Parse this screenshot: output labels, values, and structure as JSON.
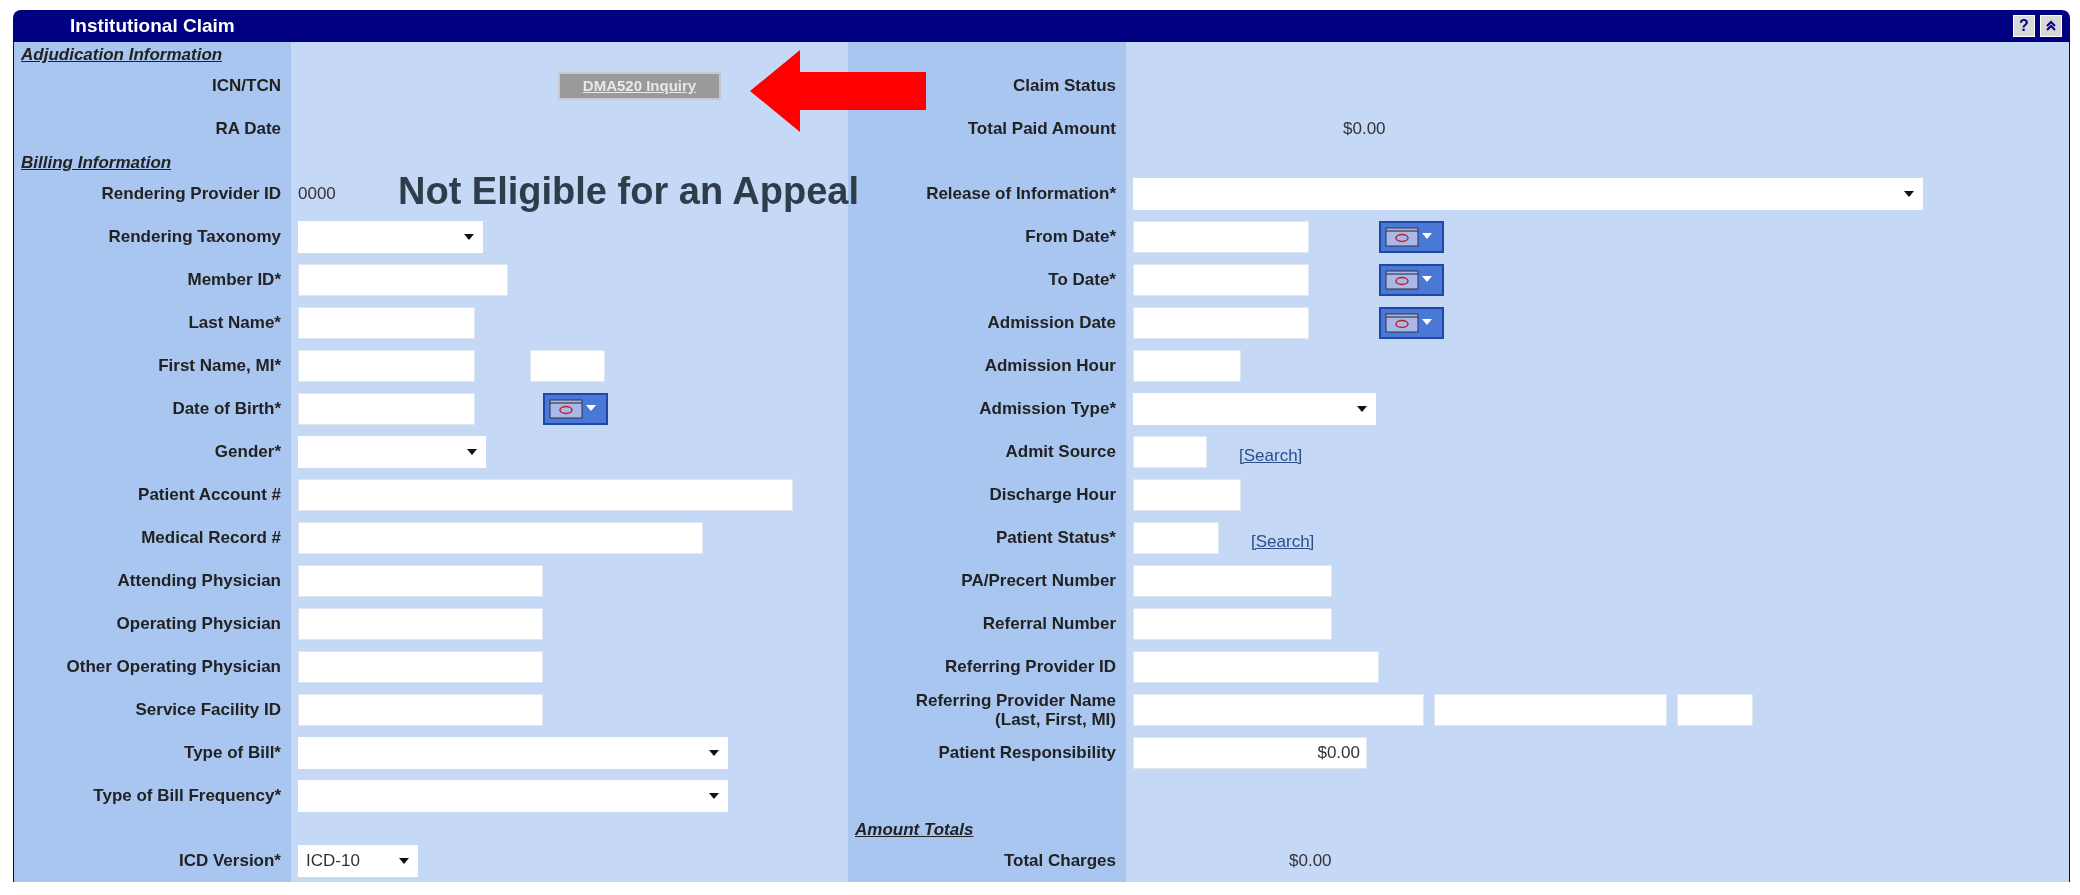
{
  "panel": {
    "title": "Institutional Claim",
    "help_button": "?"
  },
  "notice": "Not Eligible for an Appeal",
  "rows": [
    {
      "left": {
        "kind": "section",
        "label": "Adjudication Information"
      },
      "right": null
    },
    {
      "left": {
        "kind": "field",
        "label": "ICN/TCN",
        "controls": [
          {
            "kind": "button",
            "text": "DMA520 Inquiry",
            "disabled": true
          }
        ]
      },
      "right": {
        "kind": "field",
        "label": "Claim Status"
      }
    },
    {
      "left": {
        "kind": "field",
        "label": "RA Date"
      },
      "right": {
        "kind": "field",
        "label": "Total Paid Amount",
        "controls": [
          {
            "kind": "text",
            "text": "$0.00"
          }
        ]
      }
    },
    {
      "left": {
        "kind": "section",
        "label": "Billing Information"
      },
      "right": null
    },
    {
      "left": {
        "kind": "field",
        "label": "Rendering Provider ID",
        "controls": [
          {
            "kind": "text",
            "text": "0000"
          }
        ]
      },
      "right": {
        "kind": "field",
        "label": "Release of Information*",
        "controls": [
          {
            "kind": "select"
          }
        ]
      }
    },
    {
      "left": {
        "kind": "field",
        "label": "Rendering Taxonomy",
        "controls": [
          {
            "kind": "select"
          }
        ]
      },
      "right": {
        "kind": "field",
        "label": "From Date*",
        "controls": [
          {
            "kind": "input"
          },
          {
            "kind": "date_picker"
          }
        ]
      }
    },
    {
      "left": {
        "kind": "field",
        "label": "Member ID*",
        "controls": [
          {
            "kind": "input"
          }
        ]
      },
      "right": {
        "kind": "field",
        "label": "To Date*",
        "controls": [
          {
            "kind": "input"
          },
          {
            "kind": "date_picker"
          }
        ]
      }
    },
    {
      "left": {
        "kind": "field",
        "label": "Last Name*",
        "controls": [
          {
            "kind": "input"
          }
        ]
      },
      "right": {
        "kind": "field",
        "label": "Admission Date",
        "controls": [
          {
            "kind": "input"
          },
          {
            "kind": "date_picker"
          }
        ]
      }
    },
    {
      "left": {
        "kind": "field",
        "label": "First Name, MI*",
        "controls": [
          {
            "kind": "input"
          },
          {
            "kind": "input"
          }
        ]
      },
      "right": {
        "kind": "field",
        "label": "Admission Hour",
        "controls": [
          {
            "kind": "input"
          }
        ]
      }
    },
    {
      "left": {
        "kind": "field",
        "label": "Date of Birth*",
        "controls": [
          {
            "kind": "input"
          },
          {
            "kind": "date_picker"
          }
        ]
      },
      "right": {
        "kind": "field",
        "label": "Admission Type*",
        "controls": [
          {
            "kind": "select"
          }
        ]
      }
    },
    {
      "left": {
        "kind": "field",
        "label": "Gender*",
        "controls": [
          {
            "kind": "select"
          }
        ]
      },
      "right": {
        "kind": "field",
        "label": "Admit Source",
        "controls": [
          {
            "kind": "input"
          },
          {
            "kind": "link",
            "text": "[Search]"
          }
        ]
      }
    },
    {
      "left": {
        "kind": "field",
        "label": "Patient Account #",
        "controls": [
          {
            "kind": "input"
          }
        ]
      },
      "right": {
        "kind": "field",
        "label": "Discharge Hour",
        "controls": [
          {
            "kind": "input"
          }
        ]
      }
    },
    {
      "left": {
        "kind": "field",
        "label": "Medical Record #",
        "controls": [
          {
            "kind": "input"
          }
        ]
      },
      "right": {
        "kind": "field",
        "label": "Patient Status*",
        "controls": [
          {
            "kind": "input"
          },
          {
            "kind": "link",
            "text": "[Search]"
          }
        ]
      }
    },
    {
      "left": {
        "kind": "field",
        "label": "Attending Physician",
        "controls": [
          {
            "kind": "input"
          }
        ]
      },
      "right": {
        "kind": "field",
        "label": "PA/Precert Number",
        "controls": [
          {
            "kind": "input"
          }
        ]
      }
    },
    {
      "left": {
        "kind": "field",
        "label": "Operating Physician",
        "controls": [
          {
            "kind": "input"
          }
        ]
      },
      "right": {
        "kind": "field",
        "label": "Referral Number",
        "controls": [
          {
            "kind": "input"
          }
        ]
      }
    },
    {
      "left": {
        "kind": "field",
        "label": "Other Operating Physician",
        "controls": [
          {
            "kind": "input"
          }
        ]
      },
      "right": {
        "kind": "field",
        "label": "Referring Provider ID",
        "controls": [
          {
            "kind": "input"
          }
        ]
      }
    },
    {
      "left": {
        "kind": "field",
        "label": "Service Facility ID",
        "controls": [
          {
            "kind": "input"
          }
        ]
      },
      "right": {
        "kind": "field",
        "label": "Referring Provider Name (Last, First, MI)",
        "controls": [
          {
            "kind": "input"
          },
          {
            "kind": "input"
          },
          {
            "kind": "input"
          }
        ]
      }
    },
    {
      "left": {
        "kind": "field",
        "label": "Type of Bill*",
        "controls": [
          {
            "kind": "select"
          }
        ]
      },
      "right": {
        "kind": "field",
        "label": "Patient Responsibility",
        "controls": [
          {
            "kind": "input",
            "value": "$0.00"
          }
        ]
      }
    },
    {
      "left": {
        "kind": "field",
        "label": "Type of Bill Frequency*",
        "controls": [
          {
            "kind": "select"
          }
        ]
      },
      "right": null
    },
    {
      "left": null,
      "right": {
        "kind": "section",
        "label": "Amount Totals"
      }
    },
    {
      "left": {
        "kind": "field",
        "label": "ICD Version*",
        "controls": [
          {
            "kind": "select",
            "value": "ICD-10"
          }
        ]
      },
      "right": {
        "kind": "field",
        "label": "Total Charges",
        "controls": [
          {
            "kind": "text",
            "text": "$0.00"
          }
        ]
      }
    }
  ]
}
